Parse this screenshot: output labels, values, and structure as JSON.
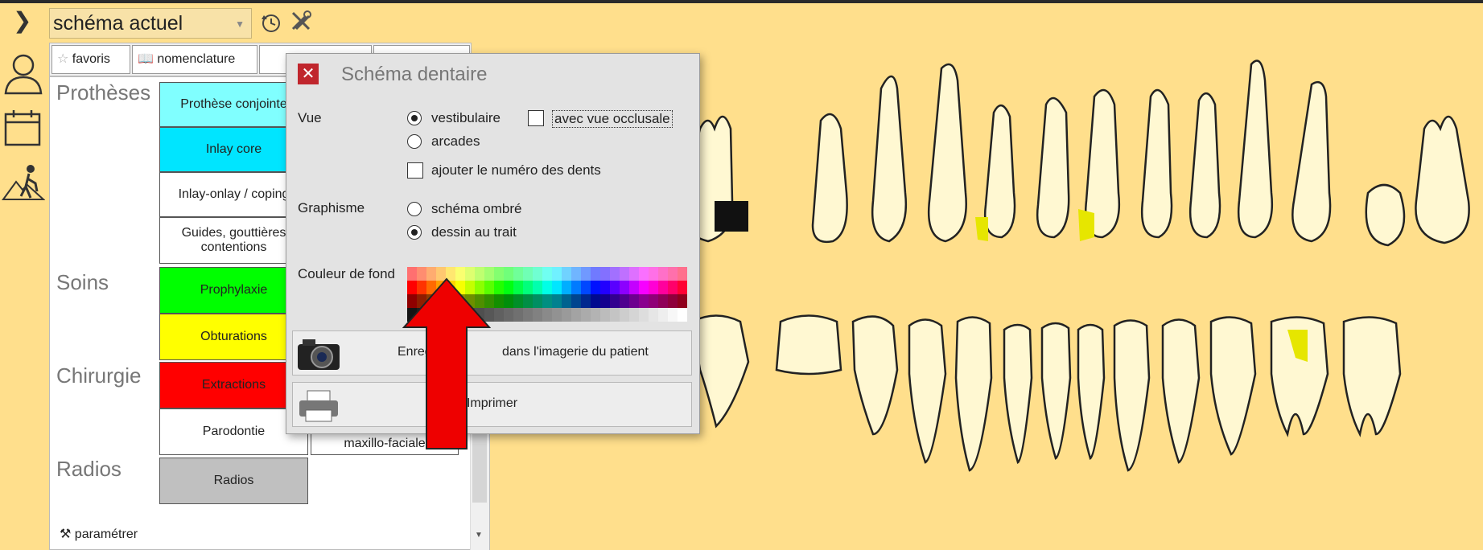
{
  "schema_select": {
    "value": "schéma actuel"
  },
  "tabs": [
    {
      "label": "favoris"
    },
    {
      "label": "nomenclature"
    }
  ],
  "sections": {
    "protheses": "Prothèses",
    "soins": "Soins",
    "chirurgie": "Chirurgie",
    "radios": "Radios"
  },
  "procedures": {
    "prothese_conjointe": "Prothèse conjointe",
    "inlay_core": "Inlay core",
    "inlay_onlay": "Inlay-onlay / coping",
    "guides_line1": "Guides, gouttières",
    "guides_line2": "contentions",
    "prophylaxie": "Prophylaxie",
    "obturations": "Obturations",
    "extractions": "Extractions",
    "parodontie": "Parodontie",
    "maxillo": "maxillo-faciale",
    "radios": "Radios"
  },
  "colors": {
    "prothese_conjointe": "#80ffff",
    "inlay_core": "#00e5ff",
    "prophylaxie": "#00ff00",
    "obturations": "#ffff00",
    "extractions": "#ff0000",
    "radios": "#c0c0c0",
    "background": "#ffdf8c",
    "tooth": "#fff8d2",
    "filling": "#e6e600",
    "arrow": "#ee0000"
  },
  "footer": {
    "parametrer": "paramétrer"
  },
  "dialog": {
    "title": "Schéma dentaire",
    "vue_label": "Vue",
    "vue_options": [
      "vestibulaire",
      "arcades"
    ],
    "vue_selected": "vestibulaire",
    "avec_vue_occlusale": "avec vue occlusale",
    "avec_vue_occlusale_checked": false,
    "ajouter_numero": "ajouter le numéro des dents",
    "ajouter_numero_checked": false,
    "graphisme_label": "Graphisme",
    "graphisme_options": [
      "schéma ombré",
      "dessin au trait"
    ],
    "graphisme_selected": "dessin au trait",
    "couleur_label": "Couleur de fond",
    "save_button": "Enregistrer dans l'imagerie du patient",
    "save_visible_left": "Enreg",
    "save_visible_right": "dans l'imagerie du patient",
    "print_button": "Imprimer"
  },
  "icons": {
    "chevron": "chevron-right-icon",
    "patient": "user-icon",
    "calendar": "calendar-icon",
    "worker": "worker-icon",
    "history": "history-icon",
    "tools": "tools-icon",
    "star": "star-icon",
    "book": "book-icon",
    "camera": "camera-icon",
    "printer": "printer-icon",
    "close": "close-icon"
  }
}
